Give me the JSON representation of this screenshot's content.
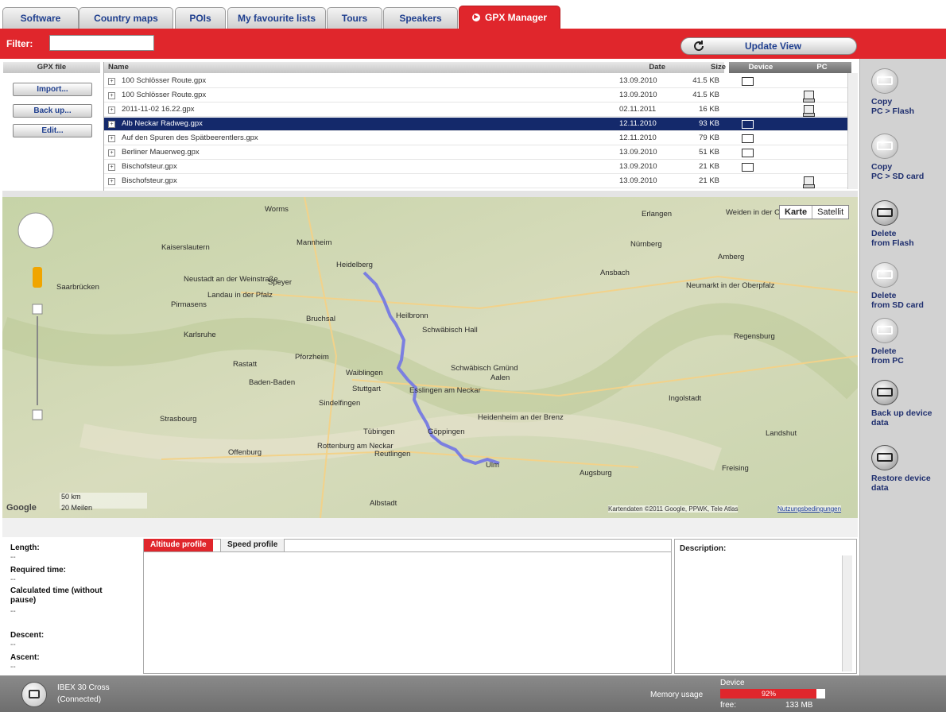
{
  "tabs": [
    {
      "label": "Software"
    },
    {
      "label": "Country maps"
    },
    {
      "label": "POIs"
    },
    {
      "label": "My favourite lists"
    },
    {
      "label": "Tours"
    },
    {
      "label": "Speakers"
    },
    {
      "label": "GPX Manager"
    }
  ],
  "filter": {
    "label": "Filter:",
    "value": ""
  },
  "update_button": {
    "label": "Update View"
  },
  "gpx_panel": {
    "header": "GPX file",
    "buttons": [
      {
        "label": "Import..."
      },
      {
        "label": "Back up..."
      },
      {
        "label": "Edit..."
      }
    ]
  },
  "table": {
    "columns": {
      "name": "Name",
      "date": "Date",
      "size": "Size",
      "device": "Device",
      "pc": "PC"
    },
    "rows": [
      {
        "name": "100 Schlösser Route.gpx",
        "date": "13.09.2010",
        "size": "41.5 KB",
        "device": true,
        "pc": false,
        "selected": false
      },
      {
        "name": "100 Schlösser Route.gpx",
        "date": "13.09.2010",
        "size": "41.5 KB",
        "device": false,
        "pc": true,
        "selected": false
      },
      {
        "name": "2011-11-02 16.22.gpx",
        "date": "02.11.2011",
        "size": "16 KB",
        "device": false,
        "pc": true,
        "selected": false
      },
      {
        "name": "Alb Neckar Radweg.gpx",
        "date": "12.11.2010",
        "size": "93 KB",
        "device": true,
        "pc": false,
        "selected": true
      },
      {
        "name": "Auf den Spuren des Spätbeerentlers.gpx",
        "date": "12.11.2010",
        "size": "79 KB",
        "device": true,
        "pc": false,
        "selected": false
      },
      {
        "name": "Berliner Mauerweg.gpx",
        "date": "13.09.2010",
        "size": "51 KB",
        "device": true,
        "pc": false,
        "selected": false
      },
      {
        "name": "Bischofsteur.gpx",
        "date": "13.09.2010",
        "size": "21 KB",
        "device": true,
        "pc": false,
        "selected": false
      },
      {
        "name": "Bischofsteur.gpx",
        "date": "13.09.2010",
        "size": "21 KB",
        "device": false,
        "pc": true,
        "selected": false
      }
    ]
  },
  "sidebar": {
    "items": [
      {
        "label": "Copy\nPC > Flash",
        "icon": "copy-to-flash-icon"
      },
      {
        "label": "Copy\nPC > SD card",
        "icon": "copy-to-sd-icon"
      },
      {
        "label": "Delete\nfrom Flash",
        "icon": "delete-flash-icon"
      },
      {
        "label": "Delete\nfrom SD card",
        "icon": "delete-sd-icon"
      },
      {
        "label": "Delete\nfrom PC",
        "icon": "delete-pc-icon"
      },
      {
        "label": "Back up device\ndata",
        "icon": "backup-device-icon"
      },
      {
        "label": "Restore device\ndata",
        "icon": "restore-device-icon"
      }
    ]
  },
  "map": {
    "type_buttons": {
      "map": "Karte",
      "satellite": "Satellit"
    },
    "scale": {
      "metric": "50 km",
      "imperial": "20 Meilen"
    },
    "attribution": "Kartendaten ©2011 Google, PPWK, Tele Atlas",
    "terms": "Nutzungsbedingungen",
    "google": "Google",
    "cities": [
      "Worms",
      "Mannheim",
      "Heidelberg",
      "Kaiserslautern",
      "Saarbrücken",
      "Pirmasens",
      "Landau in der Pfalz",
      "Neustadt an der Weinstraße",
      "Speyer",
      "Karlsruhe",
      "Bruchsal",
      "Heilbronn",
      "Schwäbisch Hall",
      "Pforzheim",
      "Rastatt",
      "Baden-Baden",
      "Stuttgart",
      "Waiblingen",
      "Esslingen am Neckar",
      "Schwäbisch Gmünd",
      "Aalen",
      "Heidenheim an der Brenz",
      "Tübingen",
      "Reutlingen",
      "Rottenburg am Neckar",
      "Ulm",
      "Strasbourg",
      "Offenburg",
      "Albstadt",
      "Augsburg",
      "Ingolstadt",
      "Nürnberg",
      "Erlangen",
      "Ansbach",
      "Amberg",
      "Weiden in der Oberpfalz",
      "Regensburg",
      "Landshut",
      "Freising",
      "Neumarkt in der Oberpfalz",
      "Sindelfingen",
      "Göppingen"
    ]
  },
  "info": {
    "length_label": "Length:",
    "length_value": "--",
    "required_label": "Required time:",
    "required_value": "--",
    "calculated_label": "Calculated time (without pause)",
    "calculated_value": "--",
    "descent_label": "Descent:",
    "descent_value": "--",
    "ascent_label": "Ascent:",
    "ascent_value": "--"
  },
  "profile_tabs": {
    "altitude": "Altitude profile",
    "speed": "Speed profile"
  },
  "description": {
    "label": "Description:"
  },
  "status": {
    "device_name": "IBEX 30 Cross",
    "device_state": "(Connected)",
    "memory_label": "Memory usage",
    "device_label": "Device",
    "usage_percent": "92%",
    "usage_fraction": 0.92,
    "free_label": "free:",
    "free_value": "133 MB"
  },
  "colors": {
    "accent": "#e0262c",
    "selection": "#14296b",
    "route": "#7b7fe0"
  }
}
